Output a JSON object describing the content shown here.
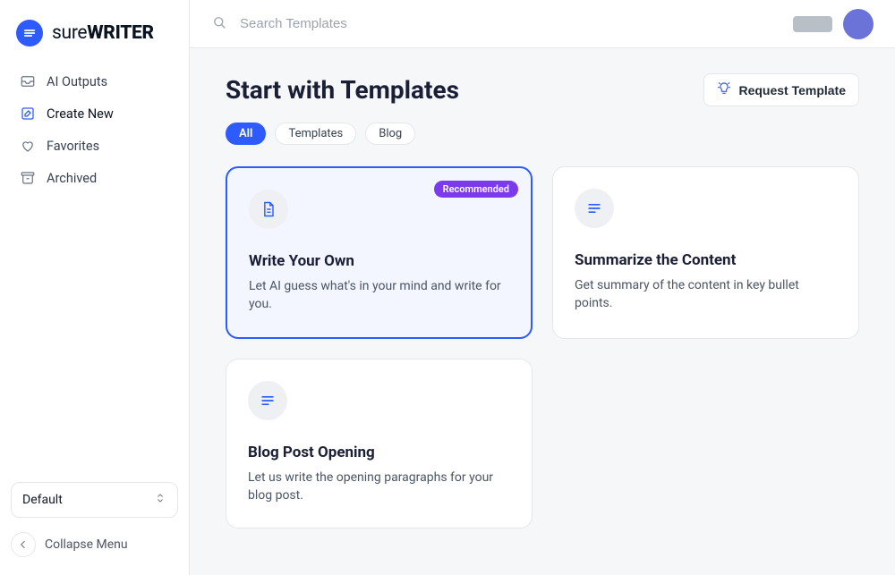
{
  "brand": {
    "pre": "sure",
    "post": "WRITER"
  },
  "sidebar": {
    "items": [
      {
        "label": "AI Outputs"
      },
      {
        "label": "Create New"
      },
      {
        "label": "Favorites"
      },
      {
        "label": "Archived"
      }
    ],
    "selector": "Default",
    "collapse": "Collapse Menu"
  },
  "search": {
    "placeholder": "Search Templates"
  },
  "page": {
    "title": "Start with Templates",
    "request_label": "Request Template"
  },
  "filters": [
    {
      "label": "All",
      "active": true
    },
    {
      "label": "Templates",
      "active": false
    },
    {
      "label": "Blog",
      "active": false
    }
  ],
  "templates": [
    {
      "title": "Write Your Own",
      "desc": "Let AI guess what's in your mind and write for you.",
      "badge": "Recommended",
      "selected": true,
      "icon": "doc"
    },
    {
      "title": "Summarize the Content",
      "desc": "Get summary of the content in key bullet points.",
      "selected": false,
      "icon": "lines"
    },
    {
      "title": "Blog Post Opening",
      "desc": "Let us write the opening paragraphs for your blog post.",
      "selected": false,
      "icon": "lines"
    }
  ]
}
